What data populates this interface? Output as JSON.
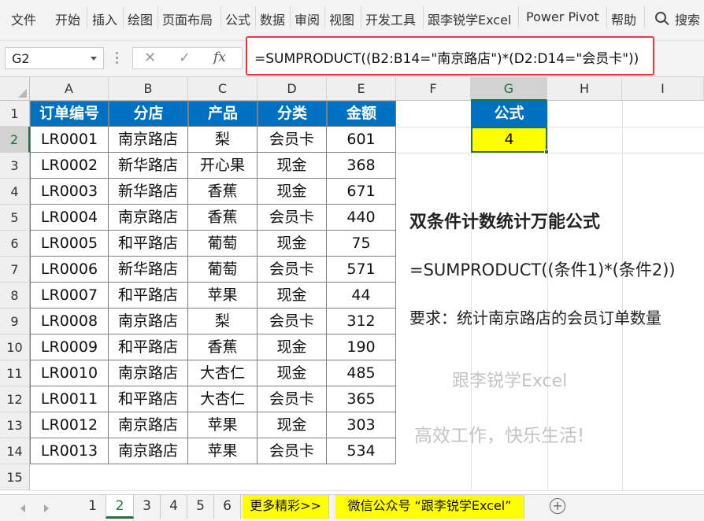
{
  "ribbon": {
    "tabs": [
      "文件",
      "开始",
      "插入",
      "绘图",
      "页面布局",
      "公式",
      "数据",
      "审阅",
      "视图",
      "开发工具",
      "跟李锐学Excel",
      "Power Pivot",
      "帮助"
    ],
    "search_label": "搜索"
  },
  "formula_bar": {
    "name_box": "G2",
    "cancel_icon": "close-icon",
    "enter_icon": "check-icon",
    "fx_label": "fx",
    "formula": "=SUMPRODUCT((B2:B14=\"南京路店\")*(D2:D14=\"会员卡\"))"
  },
  "grid": {
    "columns": [
      "A",
      "B",
      "C",
      "D",
      "E",
      "F",
      "G",
      "H",
      "I"
    ],
    "rows": [
      "1",
      "2",
      "3",
      "4",
      "5",
      "6",
      "7",
      "8",
      "9",
      "10",
      "11",
      "12",
      "13",
      "14",
      "15"
    ],
    "selected_cell": "G2"
  },
  "table": {
    "headers": [
      "订单编号",
      "分店",
      "产品",
      "分类",
      "金额"
    ],
    "rows": [
      [
        "LR0001",
        "南京路店",
        "梨",
        "会员卡",
        "601"
      ],
      [
        "LR0002",
        "新华路店",
        "开心果",
        "现金",
        "368"
      ],
      [
        "LR0003",
        "新华路店",
        "香蕉",
        "现金",
        "671"
      ],
      [
        "LR0004",
        "南京路店",
        "香蕉",
        "会员卡",
        "440"
      ],
      [
        "LR0005",
        "和平路店",
        "葡萄",
        "现金",
        "75"
      ],
      [
        "LR0006",
        "新华路店",
        "葡萄",
        "会员卡",
        "571"
      ],
      [
        "LR0007",
        "和平路店",
        "苹果",
        "现金",
        "44"
      ],
      [
        "LR0008",
        "南京路店",
        "梨",
        "会员卡",
        "312"
      ],
      [
        "LR0009",
        "和平路店",
        "香蕉",
        "现金",
        "190"
      ],
      [
        "LR0010",
        "南京路店",
        "大杏仁",
        "现金",
        "485"
      ],
      [
        "LR0011",
        "和平路店",
        "大杏仁",
        "会员卡",
        "365"
      ],
      [
        "LR0012",
        "南京路店",
        "苹果",
        "现金",
        "303"
      ],
      [
        "LR0013",
        "南京路店",
        "苹果",
        "会员卡",
        "534"
      ]
    ]
  },
  "result": {
    "header": "公式",
    "value": "4"
  },
  "notes": {
    "title": "双条件计数统计万能公式",
    "formula": "=SUMPRODUCT((条件1)*(条件2))",
    "requirement": "要求：统计南京路店的会员订单数量"
  },
  "watermark": {
    "line1": "跟李锐学Excel",
    "line2": "高效工作，快乐生活!"
  },
  "sheet_tabs": {
    "sheets": [
      "1",
      "2",
      "3",
      "4",
      "5",
      "6"
    ],
    "active": "2",
    "more": "更多精彩>>",
    "wechat": "微信公众号 “跟李锐学Excel”"
  },
  "colors": {
    "header_blue": "#0070c0",
    "highlight_yellow": "#ffff00",
    "excel_green": "#217346",
    "formula_outline_red": "#e63b3b"
  }
}
